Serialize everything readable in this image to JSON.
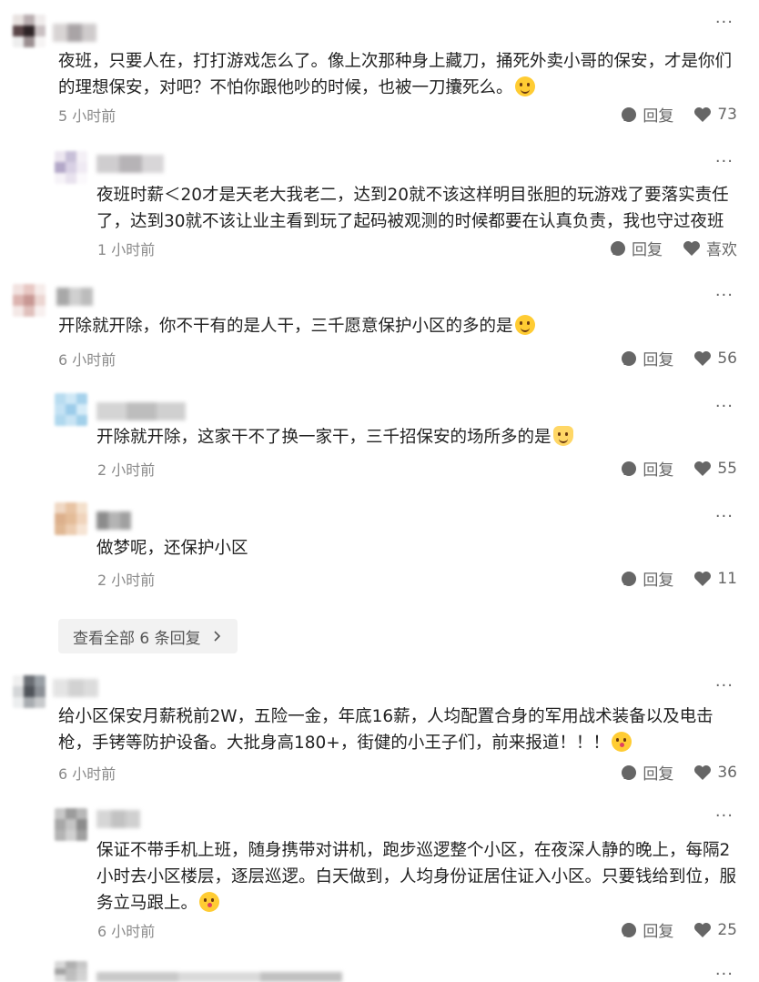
{
  "comments": [
    {
      "text": "夜班，只要人在，打打游戏怎么了。像上次那种身上藏刀，捅死外卖小哥的保安，才是你们的理想保安，对吧？不怕你跟他吵的时候，也被一刀攮死么。",
      "emoji": "laugh-cry-emoji",
      "time": "5 小时前",
      "reply_label": "回复",
      "likes": "73"
    },
    {
      "text": "夜班时薪＜20才是天老大我老二，达到20就不该这样明目张胆的玩游戏了要落实责任了，达到30就不该让业主看到玩了起码被观测的时候都要在认真负责，我也守过夜班",
      "time": "1 小时前",
      "reply_label": "回复",
      "likes": "喜欢"
    },
    {
      "text": "开除就开除，你不干有的是人干，三千愿意保护小区的多的是",
      "emoji": "grin-emoji",
      "time": "6 小时前",
      "reply_label": "回复",
      "likes": "56"
    },
    {
      "text": "开除就开除，这家干不了换一家干，三千招保安的场所多的是",
      "emoji": "cat-emoji",
      "time": "2 小时前",
      "reply_label": "回复",
      "likes": "55"
    },
    {
      "text": "做梦呢，还保护小区",
      "time": "2 小时前",
      "reply_label": "回复",
      "likes": "11"
    },
    {
      "text": "给小区保安月薪税前2W，五险一金，年底16薪，人均配置合身的军用战术装备以及电击枪，手铐等防护设备。大批身高180+，街健的小王子们，前来报道！！！",
      "emoji": "kiss-emoji",
      "time": "6 小时前",
      "reply_label": "回复",
      "likes": "36"
    },
    {
      "text": "保证不带手机上班，随身携带对讲机，跑步巡逻整个小区，在夜深人静的晚上，每隔2小时去小区楼层，逐层巡逻。白天做到，人均身份证居住证入小区。只要钱给到位，服务立马跟上。",
      "emoji": "kiss-emoji",
      "time": "6 小时前",
      "reply_label": "回复",
      "likes": "25"
    }
  ],
  "view_all": {
    "label": "查看全部 6 条回复",
    "chevron": "chevron-right-icon"
  },
  "more_label": "···"
}
